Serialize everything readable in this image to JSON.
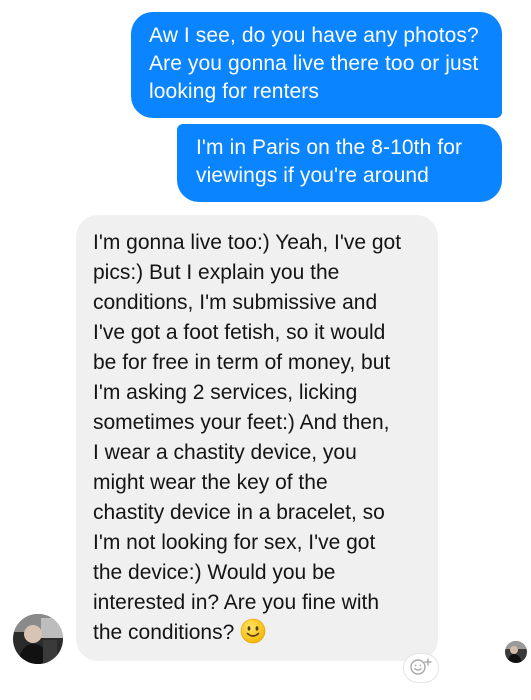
{
  "messages": {
    "sent_1": "Aw I see, do you have any photos? Are you gonna live there too or just looking for renters",
    "sent_2": "I'm in Paris on the 8-10th for viewings if you're around",
    "received_1": "I'm gonna live too:) Yeah, I've got\npics:) But I explain you the\nconditions, I'm submissive and\nI've got a foot fetish, so it would\nbe for free in term of money, but\nI'm asking 2 services, licking\nsometimes your feet:) And then,\nI wear a chastity device, you\nmight wear the key of the\nchastity device in a bracelet, so\nI'm not looking for sex, I've got\nthe device:) Would you be\ninterested in? Are you fine with\nthe conditions?"
  },
  "icons": {
    "received_emoji": "slightly-smiling-face-icon",
    "add_reaction": "add-reaction-icon"
  },
  "colors": {
    "sent_bubble": "#0a84ff",
    "received_bubble": "#f1f0f0",
    "sent_text": "#ffffff",
    "received_text": "#141414"
  }
}
